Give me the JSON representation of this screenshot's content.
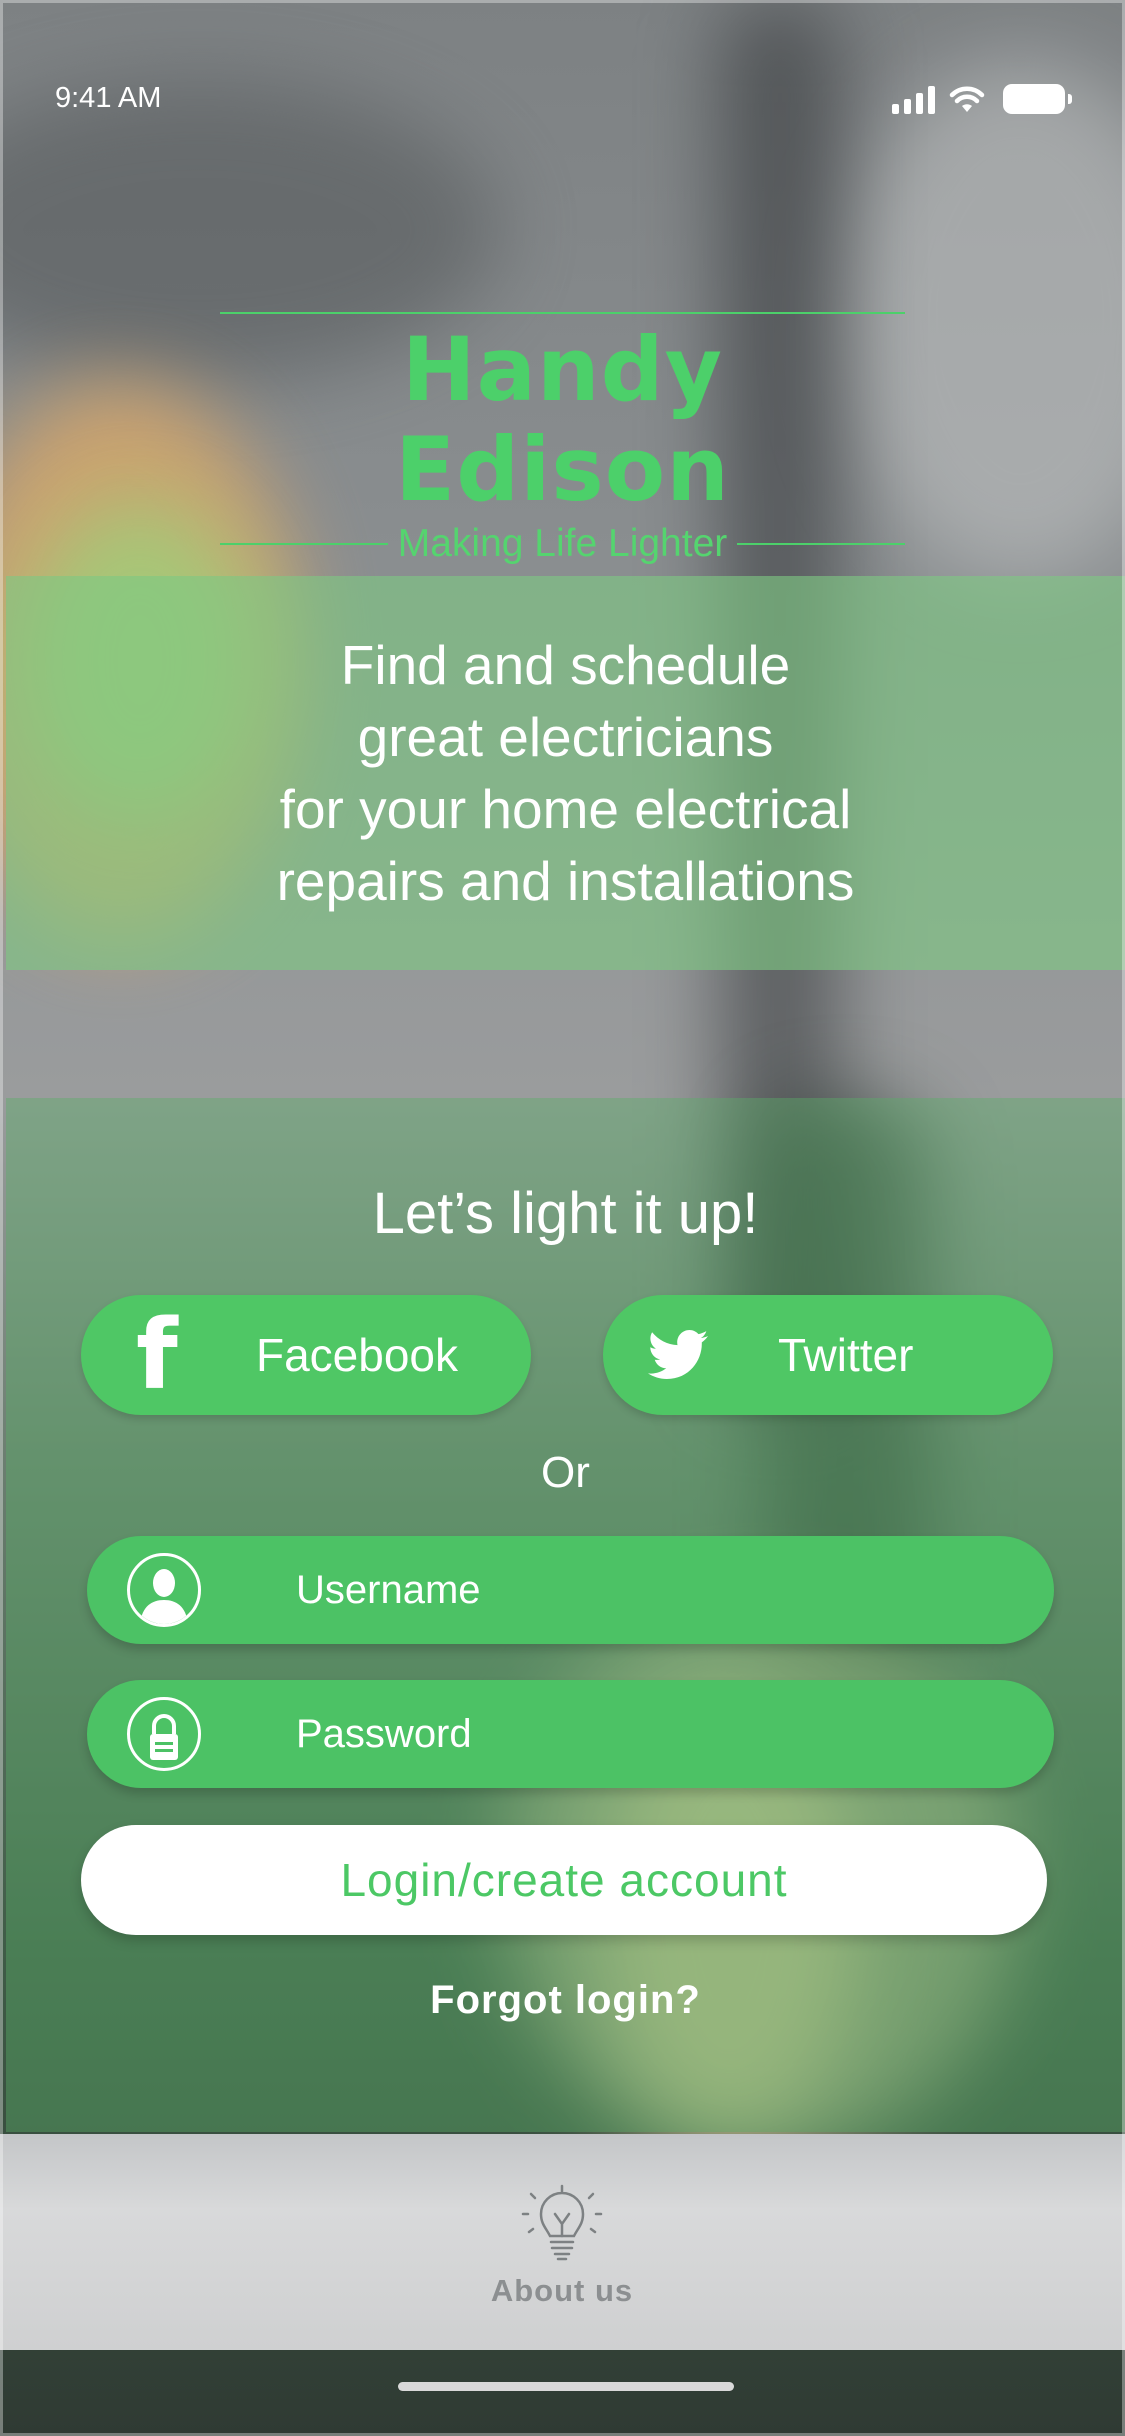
{
  "status_bar": {
    "time": "9:41 AM"
  },
  "brand": {
    "name": "Handy Edison",
    "tagline": "Making Life Lighter",
    "accent_color": "#4cd06a"
  },
  "hero": {
    "text": "Find and schedule\ngreat electricians\nfor your home electrical\nrepairs and installations"
  },
  "login": {
    "heading": "Let’s light it up!",
    "facebook_label": "Facebook",
    "twitter_label": "Twitter",
    "or_label": "Or",
    "username_placeholder": "Username",
    "password_placeholder": "Password",
    "submit_label": "Login/create account",
    "forgot_label": "Forgot login?"
  },
  "tab_bar": {
    "items": [
      {
        "label": "About us",
        "icon": "lightbulb-icon"
      }
    ]
  },
  "icons": {
    "facebook": "facebook-icon",
    "twitter": "twitter-icon",
    "user": "user-icon",
    "lock": "lock-icon",
    "signal": "cellular-signal-icon",
    "wifi": "wifi-icon",
    "battery": "battery-icon"
  }
}
